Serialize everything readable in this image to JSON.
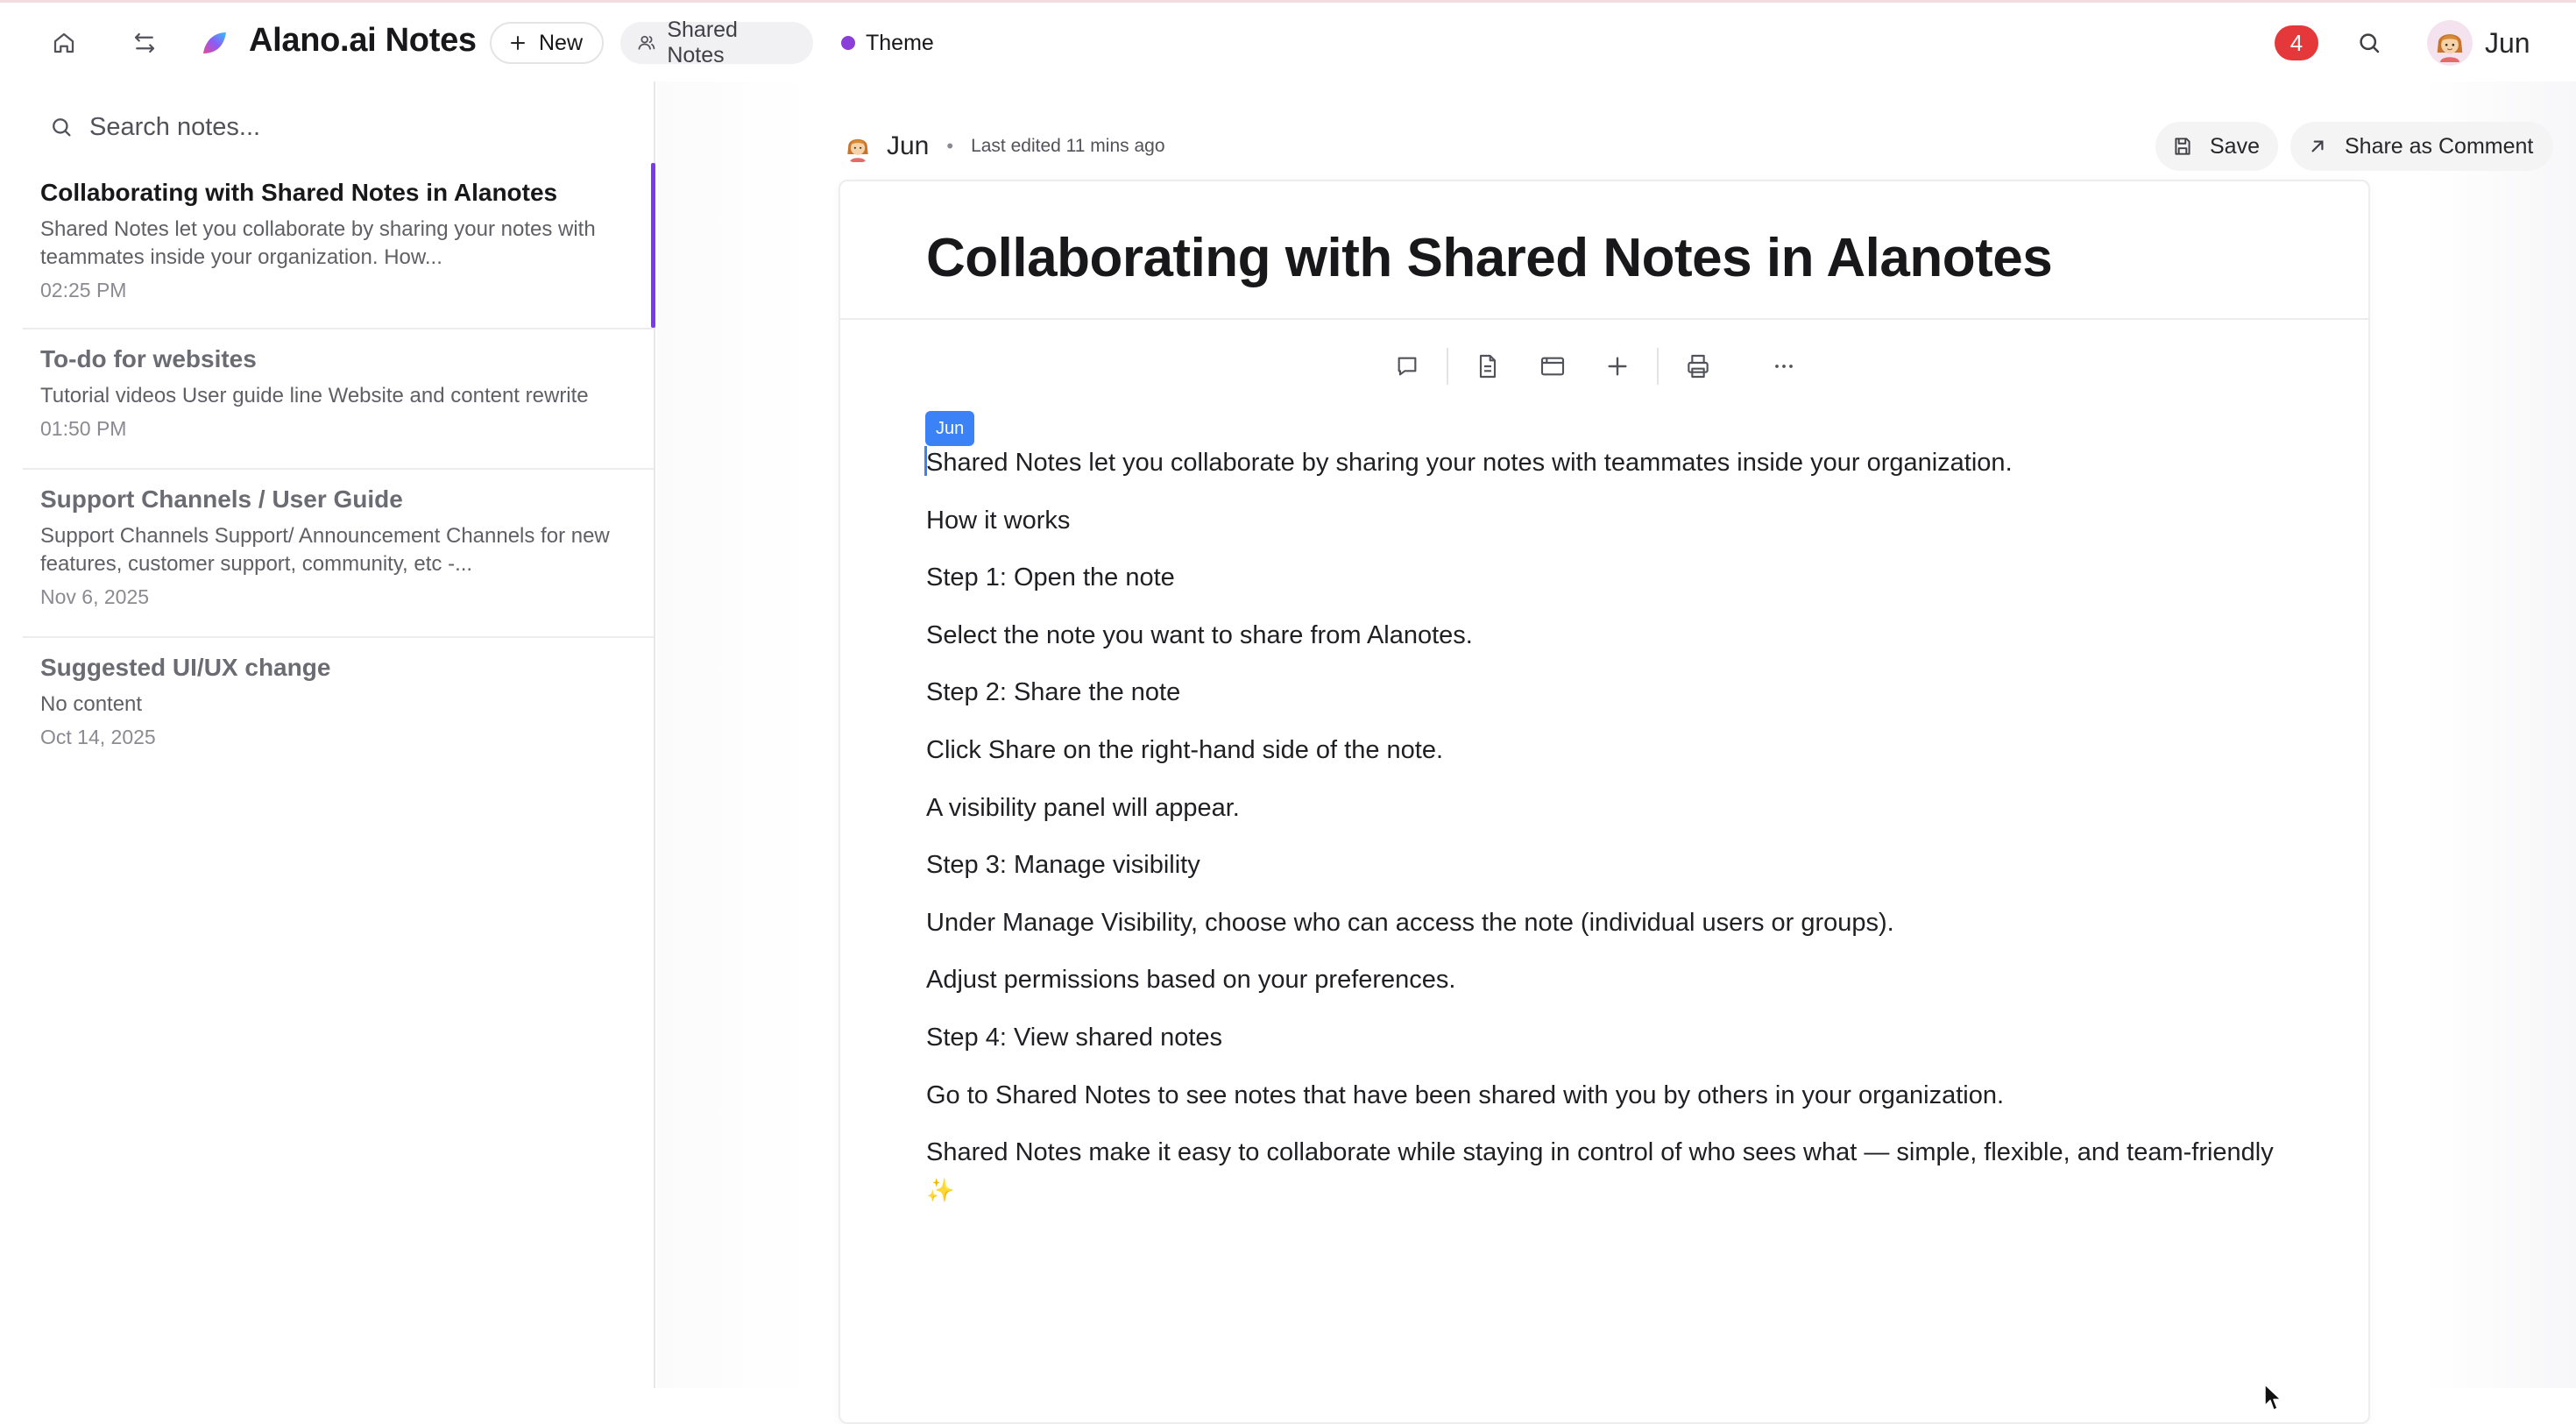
{
  "app": {
    "title": "Alano.ai Notes",
    "new_label": "New",
    "shared_label": "Shared Notes",
    "theme_label": "Theme",
    "theme_color": "#8b3fd9",
    "notification_count": "4",
    "user_name": "Jun",
    "icons": [
      "home-icon",
      "swap-icon",
      "brand-logo",
      "plus-icon",
      "users-icon",
      "search-icon",
      "avatar"
    ]
  },
  "sidebar": {
    "search_placeholder": "Search notes...",
    "notes": [
      {
        "title": "Collaborating with Shared Notes in Alanotes",
        "preview": "Shared Notes let you collaborate by sharing your notes with teammates inside your organization. How...",
        "date": "02:25 PM",
        "active": true
      },
      {
        "title": "To-do for websites",
        "preview": "Tutorial videos User guide line Website and content rewrite",
        "date": "01:50 PM",
        "active": false
      },
      {
        "title": "Support Channels / User Guide",
        "preview": "Support Channels Support/ Announcement Channels for new features, customer support, community, etc -...",
        "date": "Nov 6, 2025",
        "active": false
      },
      {
        "title": "Suggested UI/UX change",
        "preview": "No content",
        "date": "Oct 14, 2025",
        "active": false
      }
    ]
  },
  "doc": {
    "author": "Jun",
    "separator": "•",
    "edited": "Last edited 11 mins ago",
    "save_label": "Save",
    "share_label": "Share as Comment",
    "title": "Collaborating with Shared Notes in Alanotes",
    "presence_label": "Jun",
    "toolbar": [
      "comment-icon",
      "document-icon",
      "window-icon",
      "plus-icon",
      "print-icon",
      "more-icon"
    ],
    "paragraphs": [
      "Shared Notes let you collaborate by sharing your notes with teammates inside your organization.",
      "How it works",
      "Step 1: Open the note",
      "Select the note you want to share from Alanotes.",
      "Step 2: Share the note",
      "Click Share on the right-hand side of the note.",
      "A visibility panel will appear.",
      "Step 3: Manage visibility",
      "Under Manage Visibility, choose who can access the note (individual users or groups).",
      "Adjust permissions based on your preferences.",
      "Step 4: View shared notes",
      "Go to Shared Notes to see notes that have been shared with you by others in your organization.",
      "Shared Notes make it easy to collaborate while staying in control of who sees what — simple, flexible, and team-friendly"
    ],
    "closing_emoji": "✨"
  }
}
